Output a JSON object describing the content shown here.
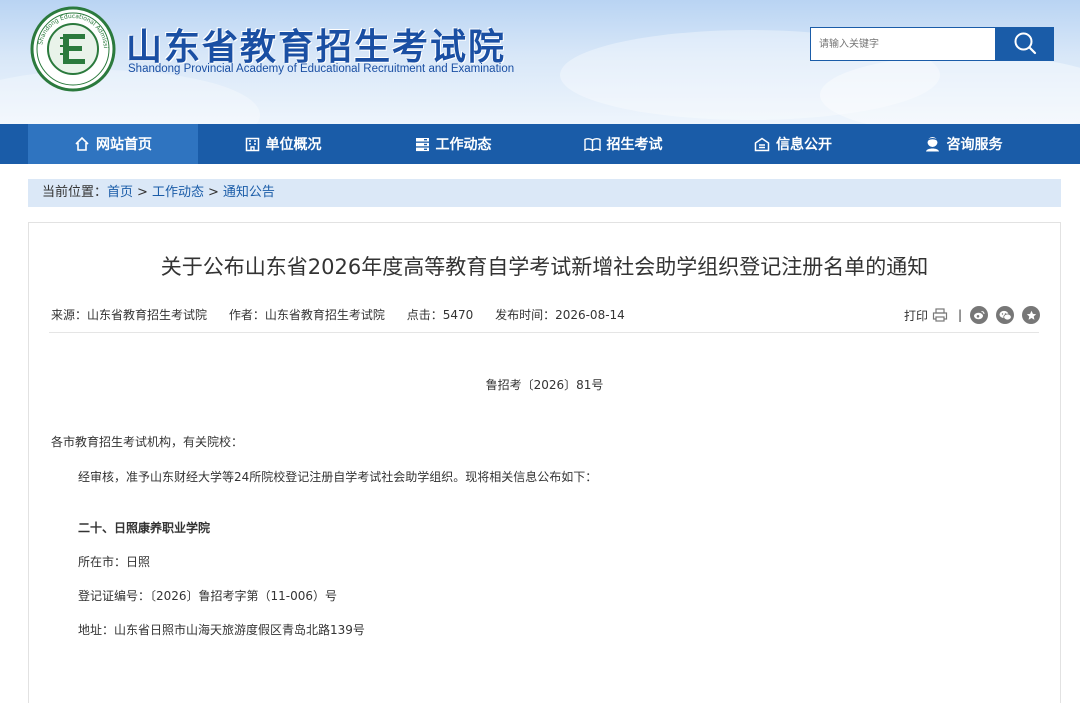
{
  "header": {
    "title_cn": "山东省教育招生考试院",
    "title_en": "Shandong Provincial Academy of Educational Recruitment and Examination",
    "logo_letter": "E",
    "logo_ring_text": "Shandong Educational Admission & Examination",
    "search": {
      "placeholder": "请输入关键字"
    }
  },
  "nav": {
    "items": [
      {
        "label": "网站首页",
        "icon": "home-icon"
      },
      {
        "label": "单位概况",
        "icon": "building-icon"
      },
      {
        "label": "工作动态",
        "icon": "server-icon"
      },
      {
        "label": "招生考试",
        "icon": "book-icon"
      },
      {
        "label": "信息公开",
        "icon": "info-icon"
      },
      {
        "label": "咨询服务",
        "icon": "user-service-icon"
      }
    ]
  },
  "breadcrumb": {
    "prefix": "当前位置：",
    "items": [
      "首页",
      "工作动态",
      "通知公告"
    ],
    "sep": ">"
  },
  "article": {
    "title": "关于公布山东省2026年度高等教育自学考试新增社会助学组织登记注册名单的通知",
    "meta": {
      "source": "来源：山东省教育招生考试院",
      "author": "作者：山东省教育招生考试院",
      "clicks": "点击：5470",
      "date": "发布时间：2026-08-14"
    },
    "tools": {
      "print_label": "打印",
      "sep": "|"
    },
    "doc_number": "鲁招考〔2026〕81号",
    "salutation": "各市教育招生考试机构，有关院校：",
    "intro": "经审核，准予山东财经大学等24所院校登记注册自学考试社会助学组织。现将相关信息公布如下：",
    "entry": {
      "heading": "二十、日照康养职业学院",
      "city": "所在市：日照",
      "reg_no": "登记证编号：〔2026〕鲁招考字第（11-006）号",
      "address": "地址：山东省日照市山海天旅游度假区青岛北路139号"
    }
  },
  "colors": {
    "primary": "#1a5ca8",
    "nav_active": "#2f74c0",
    "breadcrumb_bg": "#dbe8f7",
    "title_blue": "#1a4fa3"
  }
}
